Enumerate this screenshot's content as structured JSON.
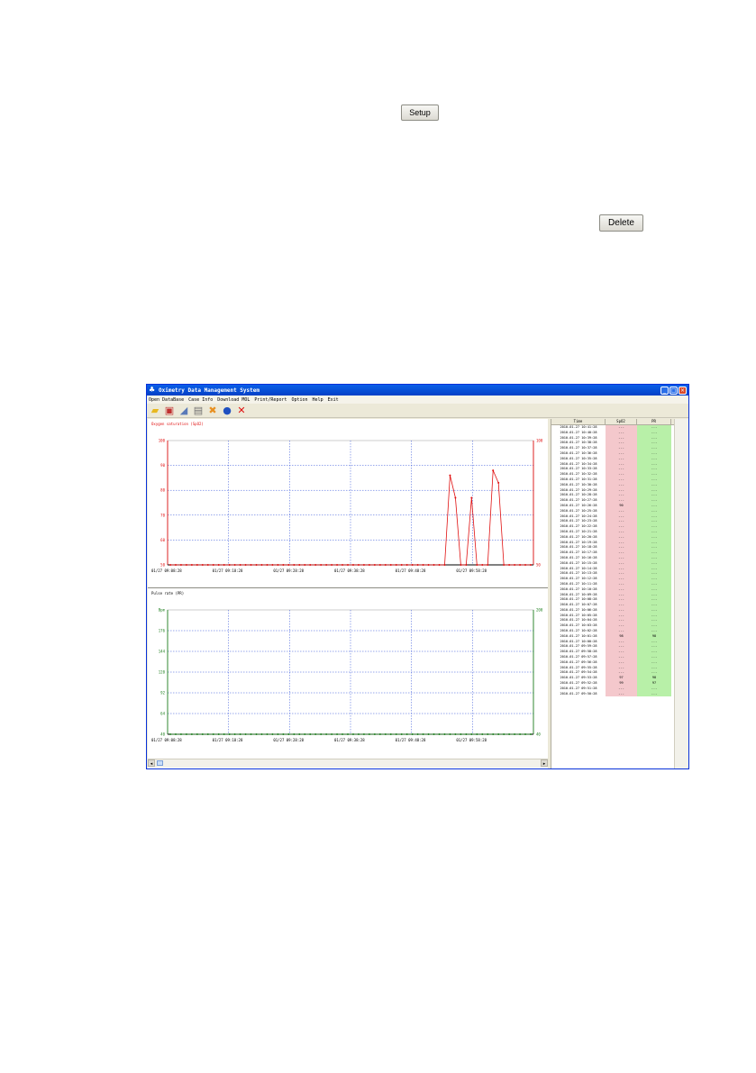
{
  "page": {
    "setup_label": "Setup",
    "delete_label": "Delete"
  },
  "window": {
    "title": "Oximetry Data Management System",
    "menu": [
      "Open DataBase",
      "Case Info",
      "Download MOL",
      "Print/Report",
      "Option",
      "Help",
      "Exit"
    ],
    "toolbar_icons": [
      "open-folder-icon",
      "case-info-icon",
      "download-icon",
      "print-icon",
      "option-tools-icon",
      "help-icon",
      "exit-icon"
    ]
  },
  "spo2_chart": {
    "title": "Oxygen saturation (SpO2)"
  },
  "pr_chart": {
    "title": "Pulse rate (PR)"
  },
  "chart_data": [
    {
      "type": "line",
      "title": "Oxygen saturation (SpO2)",
      "color": "#e01010",
      "y_ticks": [
        "100",
        "90",
        "80",
        "70",
        "60",
        "50"
      ],
      "right_ticks": [
        "100",
        "50"
      ],
      "x_ticks": [
        "01/27 09:08:28",
        "01/27 09:18:28",
        "01/27 09:28:28",
        "01/27 09:38:28",
        "01/27 09:48:28",
        "01/27 09:58:28"
      ],
      "ylim": [
        50,
        100
      ],
      "x": [
        0,
        1,
        2,
        3,
        4,
        5,
        6,
        7,
        8,
        9,
        10,
        11,
        12,
        13,
        14,
        15,
        16,
        17,
        18,
        19,
        20,
        21,
        22,
        23,
        24,
        25,
        26,
        27,
        28,
        29,
        30,
        31,
        32,
        33,
        34,
        35,
        36,
        37,
        38,
        39,
        40,
        41,
        42,
        43,
        44,
        45,
        46,
        47,
        48,
        49,
        50,
        51,
        52,
        53,
        54,
        55,
        56,
        57,
        58,
        59,
        60,
        61,
        62,
        63,
        64,
        65,
        66,
        67
      ],
      "values": [
        50,
        50,
        50,
        50,
        50,
        50,
        50,
        50,
        50,
        50,
        50,
        50,
        50,
        50,
        50,
        50,
        50,
        50,
        50,
        50,
        50,
        50,
        50,
        50,
        50,
        50,
        50,
        50,
        50,
        50,
        50,
        50,
        50,
        50,
        50,
        50,
        50,
        50,
        50,
        50,
        50,
        50,
        50,
        50,
        50,
        50,
        50,
        50,
        50,
        50,
        50,
        50,
        86,
        77,
        50,
        50,
        77,
        50,
        50,
        50,
        88,
        83,
        50,
        50,
        50,
        50,
        50,
        50
      ]
    },
    {
      "type": "line",
      "title": "Pulse rate (PR)",
      "color": "#208020",
      "y_ticks": [
        "Bpm",
        "176",
        "144",
        "120",
        "92",
        "64",
        "40"
      ],
      "right_ticks": [
        "200",
        "40"
      ],
      "x_ticks": [
        "01/27 09:08:28",
        "01/27 09:18:28",
        "01/27 09:28:28",
        "01/27 09:38:28",
        "01/27 09:48:28",
        "01/27 09:58:28"
      ],
      "ylim": [
        40,
        200
      ],
      "x": [
        0,
        1,
        2,
        3,
        4,
        5,
        6,
        7,
        8,
        9,
        10,
        11,
        12,
        13,
        14,
        15,
        16,
        17,
        18,
        19,
        20,
        21,
        22,
        23,
        24,
        25,
        26,
        27,
        28,
        29,
        30,
        31,
        32,
        33,
        34,
        35,
        36,
        37,
        38,
        39,
        40,
        41,
        42,
        43,
        44,
        45,
        46,
        47,
        48,
        49,
        50,
        51,
        52,
        53,
        54,
        55,
        56,
        57,
        58,
        59,
        60,
        61,
        62,
        63,
        64,
        65,
        66,
        67
      ],
      "values": [
        40,
        40,
        40,
        40,
        40,
        40,
        40,
        40,
        40,
        40,
        40,
        40,
        40,
        40,
        40,
        40,
        40,
        40,
        40,
        40,
        40,
        40,
        40,
        40,
        40,
        40,
        40,
        40,
        40,
        40,
        40,
        40,
        40,
        40,
        40,
        40,
        40,
        40,
        40,
        40,
        40,
        40,
        40,
        40,
        40,
        40,
        40,
        40,
        40,
        40,
        40,
        40,
        40,
        40,
        40,
        40,
        40,
        40,
        40,
        40,
        40,
        40,
        40,
        40,
        40,
        40,
        40,
        40
      ]
    }
  ],
  "table": {
    "headers": [
      "Time",
      "SpO2",
      "PR"
    ],
    "rows": [
      [
        "2010-01-27 10:41:28",
        "---",
        "---"
      ],
      [
        "2010-01-27 10:40:28",
        "---",
        "---"
      ],
      [
        "2010-01-27 10:39:28",
        "---",
        "---"
      ],
      [
        "2010-01-27 10:38:28",
        "---",
        "---"
      ],
      [
        "2010-01-27 10:37:28",
        "---",
        "---"
      ],
      [
        "2010-01-27 10:36:28",
        "---",
        "---"
      ],
      [
        "2010-01-27 10:35:28",
        "---",
        "---"
      ],
      [
        "2010-01-27 10:34:28",
        "---",
        "---"
      ],
      [
        "2010-01-27 10:33:28",
        "---",
        "---"
      ],
      [
        "2010-01-27 10:32:28",
        "---",
        "---"
      ],
      [
        "2010-01-27 10:31:28",
        "---",
        "---"
      ],
      [
        "2010-01-27 10:30:28",
        "---",
        "---"
      ],
      [
        "2010-01-27 10:29:28",
        "---",
        "---"
      ],
      [
        "2010-01-27 10:28:28",
        "---",
        "---"
      ],
      [
        "2010-01-27 10:27:28",
        "---",
        "---"
      ],
      [
        "2010-01-27 10:26:28",
        "90",
        "---"
      ],
      [
        "2010-01-27 10:25:28",
        "---",
        "---"
      ],
      [
        "2010-01-27 10:24:28",
        "---",
        "---"
      ],
      [
        "2010-01-27 10:23:28",
        "---",
        "---"
      ],
      [
        "2010-01-27 10:22:28",
        "---",
        "---"
      ],
      [
        "2010-01-27 10:21:28",
        "---",
        "---"
      ],
      [
        "2010-01-27 10:20:28",
        "---",
        "---"
      ],
      [
        "2010-01-27 10:19:28",
        "---",
        "---"
      ],
      [
        "2010-01-27 10:18:28",
        "---",
        "---"
      ],
      [
        "2010-01-27 10:17:28",
        "---",
        "---"
      ],
      [
        "2010-01-27 10:16:28",
        "---",
        "---"
      ],
      [
        "2010-01-27 10:15:28",
        "---",
        "---"
      ],
      [
        "2010-01-27 10:14:28",
        "---",
        "---"
      ],
      [
        "2010-01-27 10:13:28",
        "---",
        "---"
      ],
      [
        "2010-01-27 10:12:28",
        "---",
        "---"
      ],
      [
        "2010-01-27 10:11:28",
        "---",
        "---"
      ],
      [
        "2010-01-27 10:10:28",
        "---",
        "---"
      ],
      [
        "2010-01-27 10:09:28",
        "---",
        "---"
      ],
      [
        "2010-01-27 10:08:28",
        "---",
        "---"
      ],
      [
        "2010-01-27 10:07:28",
        "---",
        "---"
      ],
      [
        "2010-01-27 10:06:28",
        "---",
        "---"
      ],
      [
        "2010-01-27 10:05:28",
        "---",
        "---"
      ],
      [
        "2010-01-27 10:04:28",
        "---",
        "---"
      ],
      [
        "2010-01-27 10:03:28",
        "---",
        "---"
      ],
      [
        "2010-01-27 10:02:28",
        "---",
        "---"
      ],
      [
        "2010-01-27 10:01:28",
        "98",
        "98"
      ],
      [
        "2010-01-27 10:00:28",
        "---",
        "---"
      ],
      [
        "2010-01-27 09:59:28",
        "---",
        "---"
      ],
      [
        "2010-01-27 09:58:28",
        "---",
        "---"
      ],
      [
        "2010-01-27 09:57:28",
        "---",
        "---"
      ],
      [
        "2010-01-27 09:56:28",
        "---",
        "---"
      ],
      [
        "2010-01-27 09:55:28",
        "---",
        "---"
      ],
      [
        "2010-01-27 09:54:28",
        "---",
        "---"
      ],
      [
        "2010-01-27 09:53:28",
        "97",
        "98"
      ],
      [
        "2010-01-27 09:52:28",
        "99",
        "97"
      ],
      [
        "2010-01-27 09:51:28",
        "---",
        "---"
      ],
      [
        "2010-01-27 09:50:28",
        "---",
        "---"
      ]
    ]
  }
}
